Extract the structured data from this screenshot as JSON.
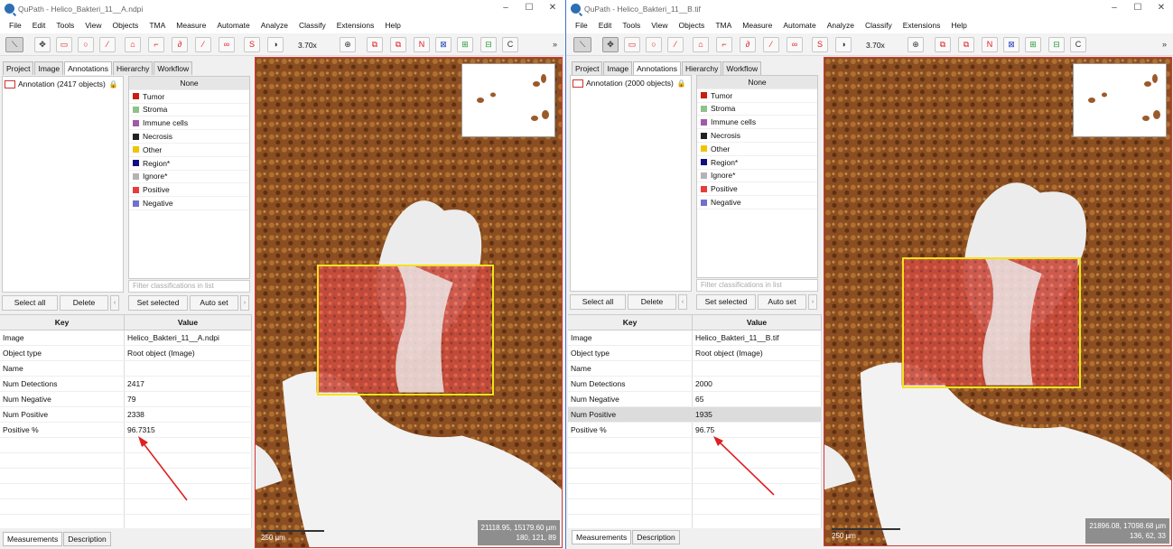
{
  "colors": {
    "accent": "#e1191c",
    "roi": "#f2e21a",
    "arrow": "#e02020",
    "viewer_border": "#dd3333"
  },
  "left": {
    "title": "QuPath - Helico_Bakteri_11__A.ndpi",
    "window_controls": [
      "–",
      "☐",
      "✕"
    ],
    "menus": [
      "File",
      "Edit",
      "Tools",
      "View",
      "Objects",
      "TMA",
      "Measure",
      "Automate",
      "Analyze",
      "Classify",
      "Extensions",
      "Help"
    ],
    "zoom": "3.70x",
    "tabs": [
      "Project",
      "Image",
      "Annotations",
      "Hierarchy",
      "Workflow"
    ],
    "active_tab": "Annotations",
    "annotation_item": "Annotation (2417 objects)",
    "classes": [
      "None",
      "Tumor",
      "Stroma",
      "Immune cells",
      "Necrosis",
      "Other",
      "Region*",
      "Ignore*",
      "Positive",
      "Negative"
    ],
    "filter_placeholder": "Filter classifications in list",
    "buttons": {
      "select_all": "Select all",
      "delete": "Delete",
      "set_selected": "Set selected",
      "auto_set": "Auto set"
    },
    "table_header": {
      "key": "Key",
      "value": "Value"
    },
    "rows": [
      {
        "key": "Image",
        "value": "Helico_Bakteri_11__A.ndpi"
      },
      {
        "key": "Object type",
        "value": "Root object (Image)"
      },
      {
        "key": "Name",
        "value": ""
      },
      {
        "key": "Num Detections",
        "value": "2417"
      },
      {
        "key": "Num Negative",
        "value": "79"
      },
      {
        "key": "Num Positive",
        "value": "2338"
      },
      {
        "key": "Positive %",
        "value": "96.7315"
      }
    ],
    "bottom_tabs": [
      "Measurements",
      "Description"
    ],
    "scalebar": "250 µm",
    "coords_line1": "21118.95, 15179.60 µm",
    "coords_line2": "180, 121, 89"
  },
  "right": {
    "title": "QuPath - Helico_Bakteri_11__B.tif",
    "window_controls": [
      "–",
      "☐",
      "✕"
    ],
    "menus": [
      "File",
      "Edit",
      "Tools",
      "View",
      "Objects",
      "TMA",
      "Measure",
      "Automate",
      "Analyze",
      "Classify",
      "Extensions",
      "Help"
    ],
    "zoom": "3.70x",
    "tabs": [
      "Project",
      "Image",
      "Annotations",
      "Hierarchy",
      "Workflow"
    ],
    "active_tab": "Annotations",
    "annotation_item": "Annotation (2000 objects)",
    "classes": [
      "None",
      "Tumor",
      "Stroma",
      "Immune cells",
      "Necrosis",
      "Other",
      "Region*",
      "Ignore*",
      "Positive",
      "Negative"
    ],
    "filter_placeholder": "Filter classifications in list",
    "buttons": {
      "select_all": "Select all",
      "delete": "Delete",
      "set_selected": "Set selected",
      "auto_set": "Auto set"
    },
    "table_header": {
      "key": "Key",
      "value": "Value"
    },
    "rows": [
      {
        "key": "Image",
        "value": "Helico_Bakteri_11__B.tif"
      },
      {
        "key": "Object type",
        "value": "Root object (Image)"
      },
      {
        "key": "Name",
        "value": ""
      },
      {
        "key": "Num Detections",
        "value": "2000"
      },
      {
        "key": "Num Negative",
        "value": "65"
      },
      {
        "key": "Num Positive",
        "value": "1935"
      },
      {
        "key": "Positive %",
        "value": "96.75"
      }
    ],
    "bottom_tabs": [
      "Measurements",
      "Description"
    ],
    "scalebar": "250 µm",
    "coords_line1": "21896.08, 17098.68 µm",
    "coords_line2": "136, 62, 33"
  },
  "class_colors": [
    "",
    "#c81e14",
    "#8fc28a",
    "#a05aa8",
    "#222222",
    "#f2c300",
    "#101080",
    "#b4b4b4",
    "#e83c3c",
    "#7070d0"
  ],
  "tool_icons": [
    "move-icon",
    "rectangle-icon",
    "ellipse-icon",
    "line-icon",
    "polygon-icon",
    "polyline-icon",
    "brush-icon",
    "wand-icon",
    "points-icon",
    "selection-mode-icon",
    "contrast-icon",
    "zoom-to-fit-icon",
    "show-annotations-icon",
    "fill-annotations-icon",
    "show-names-icon",
    "show-tma-grid-icon",
    "show-detections-icon",
    "fill-detections-icon",
    "show-connections-icon"
  ]
}
